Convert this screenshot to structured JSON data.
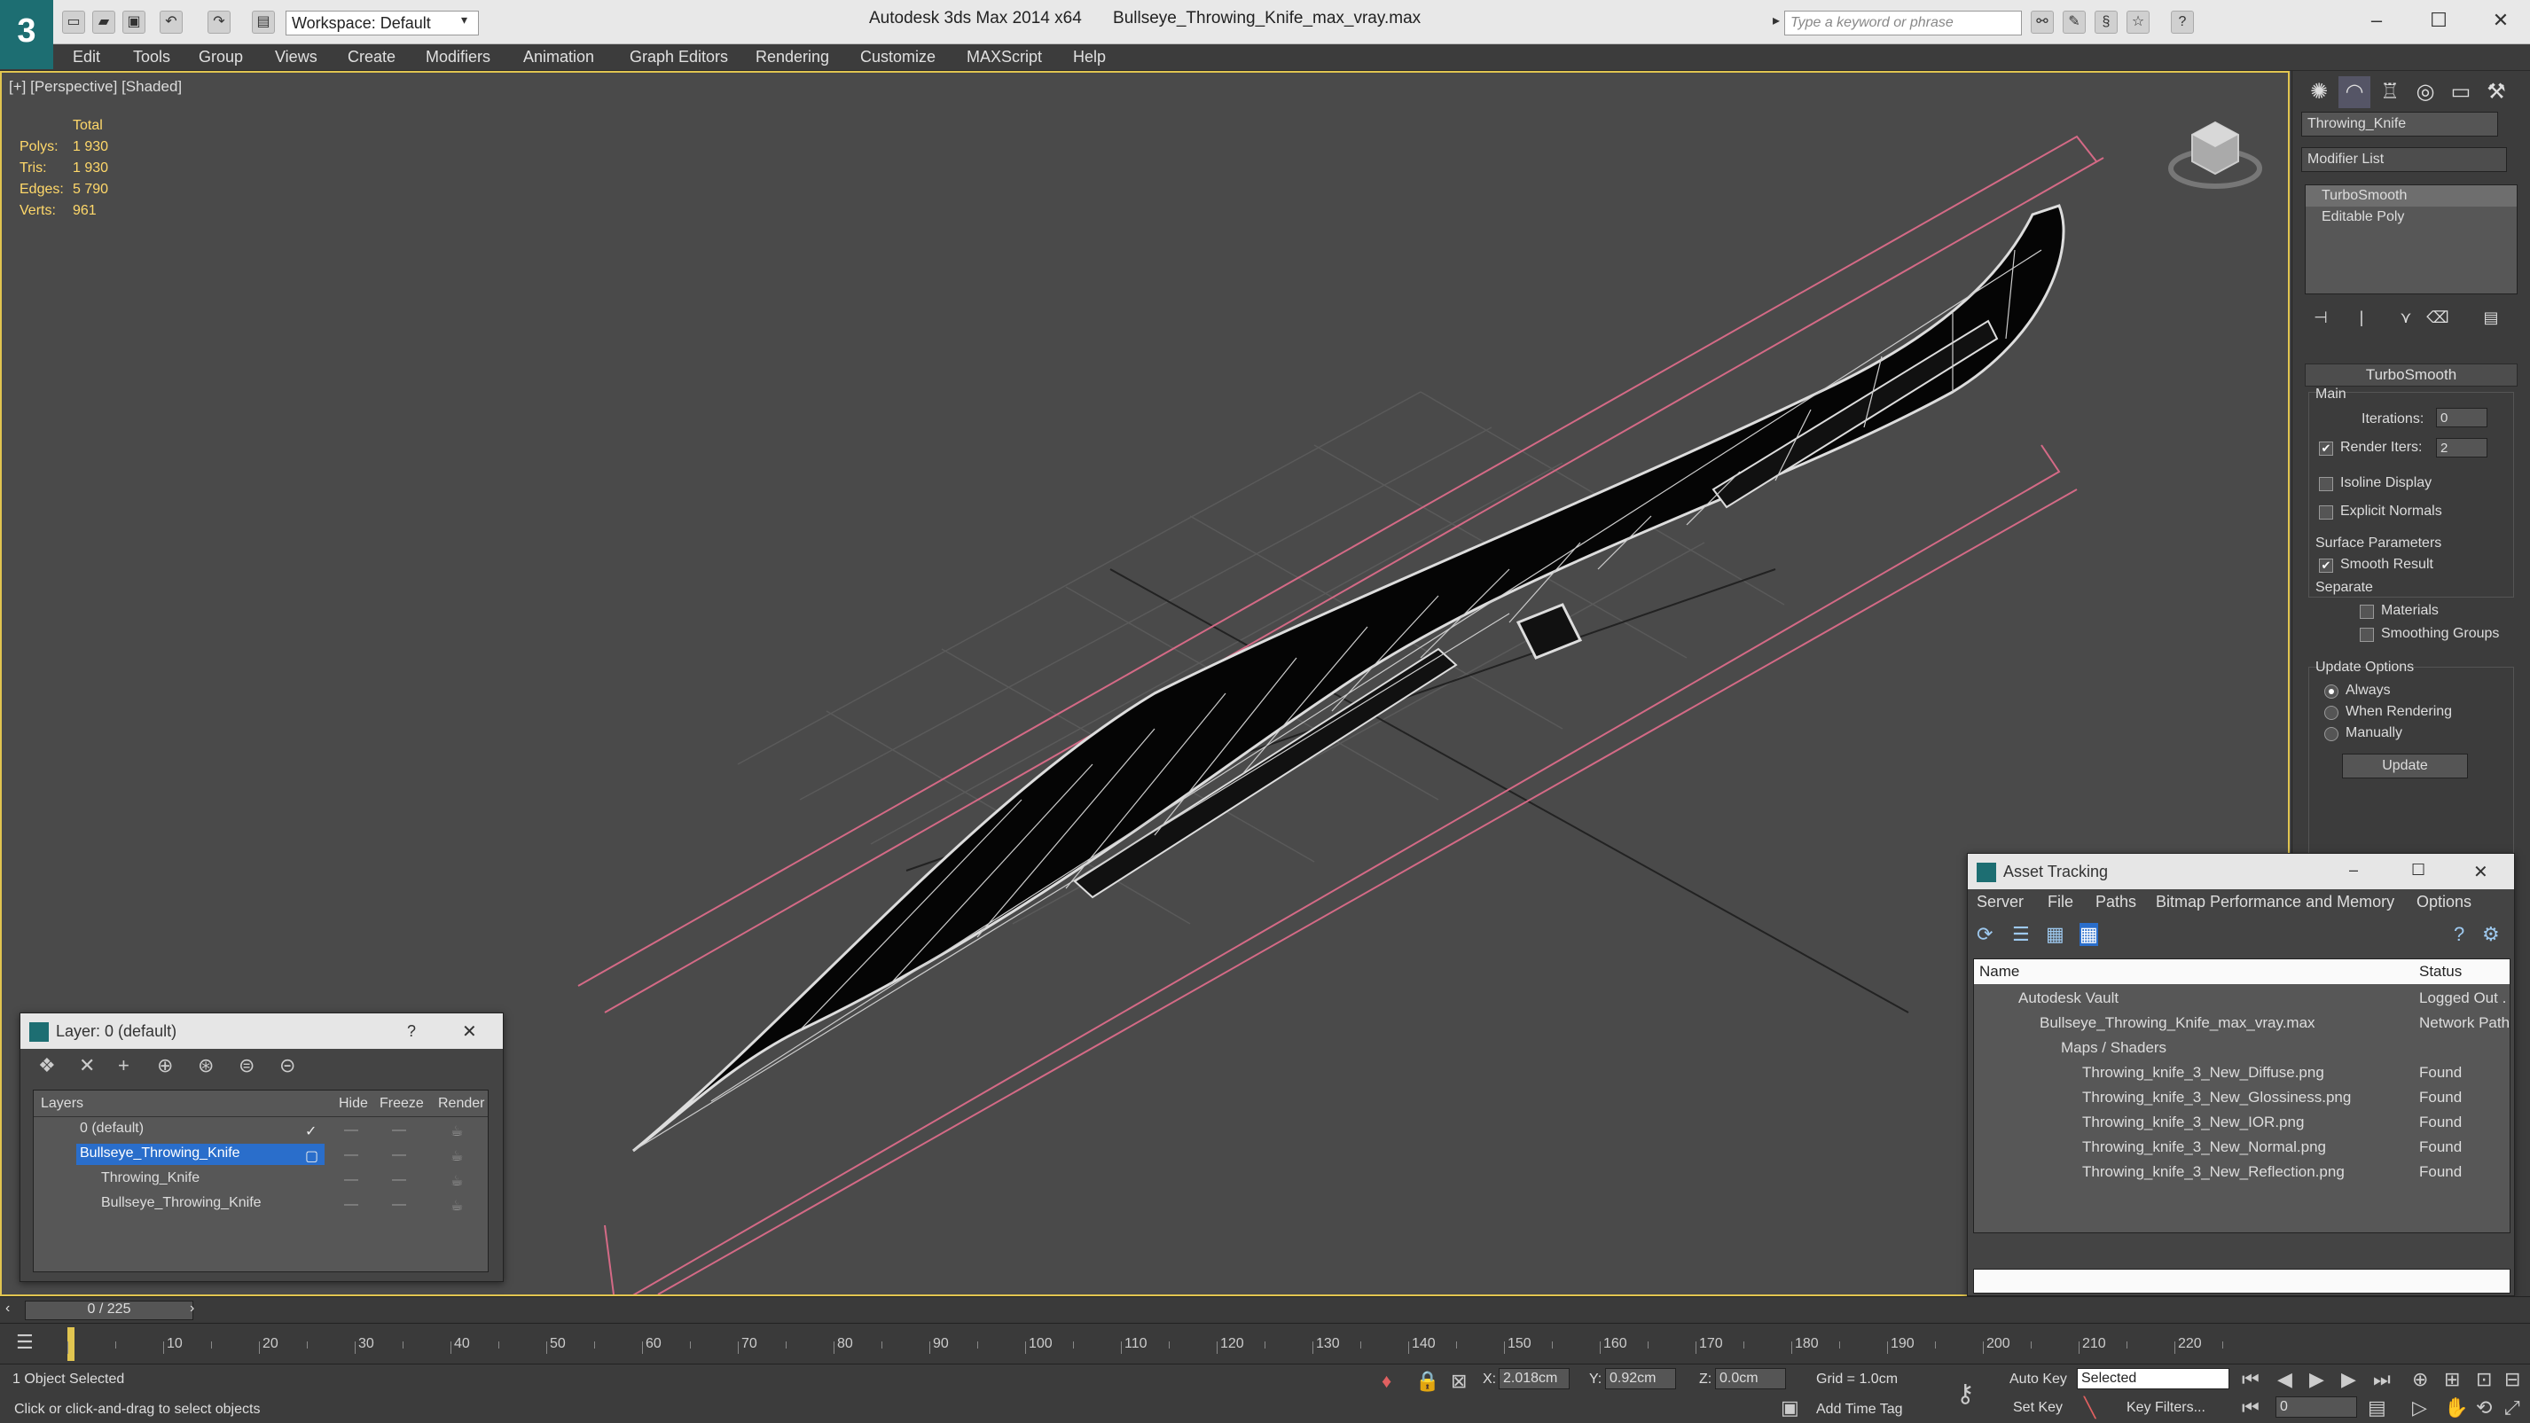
{
  "app": {
    "title": "Autodesk 3ds Max  2014 x64",
    "filename": "Bullseye_Throwing_Knife_max_vray.max",
    "workspace": "Workspace: Default",
    "search_placeholder": "Type a keyword or phrase"
  },
  "menu": [
    "Edit",
    "Tools",
    "Group",
    "Views",
    "Create",
    "Modifiers",
    "Animation",
    "Graph Editors",
    "Rendering",
    "Customize",
    "MAXScript",
    "Help"
  ],
  "viewport": {
    "label": "[+] [Perspective] [Shaded]",
    "stats": {
      "header": "Total",
      "rows": [
        {
          "k": "Polys:",
          "v": "1 930"
        },
        {
          "k": "Tris:",
          "v": "1 930"
        },
        {
          "k": "Edges:",
          "v": "5 790"
        },
        {
          "k": "Verts:",
          "v": "961"
        }
      ]
    }
  },
  "command_panel": {
    "object_name": "Throwing_Knife",
    "modifier_list": "Modifier List",
    "stack": [
      "TurboSmooth",
      "Editable Poly"
    ],
    "rollout": "TurboSmooth",
    "main": "Main",
    "iterations_label": "Iterations:",
    "iterations": "0",
    "render_iters_label": "Render Iters:",
    "render_iters": "2",
    "isoline": "Isoline Display",
    "explicit": "Explicit Normals",
    "surface": "Surface Parameters",
    "smooth": "Smooth Result",
    "separate": "Separate",
    "materials": "Materials",
    "smoothing_groups": "Smoothing Groups",
    "update_options": "Update Options",
    "always": "Always",
    "when_rendering": "When Rendering",
    "manually": "Manually",
    "update_btn": "Update"
  },
  "layer_window": {
    "title": "Layer: 0 (default)",
    "help": "?",
    "cols": {
      "layers": "Layers",
      "hide": "Hide",
      "freeze": "Freeze",
      "render": "Render"
    },
    "rows": [
      "0 (default)",
      "Bullseye_Throwing_Knife",
      "Throwing_Knife",
      "Bullseye_Throwing_Knife"
    ]
  },
  "asset_window": {
    "title": "Asset Tracking",
    "menu": [
      "Server",
      "File",
      "Paths",
      "Bitmap Performance and Memory",
      "Options"
    ],
    "col_name": "Name",
    "col_status": "Status",
    "rows": [
      {
        "name": "Autodesk Vault",
        "status": "Logged Out ."
      },
      {
        "name": "Bullseye_Throwing_Knife_max_vray.max",
        "status": "Network Path"
      },
      {
        "name": "Maps / Shaders",
        "status": ""
      },
      {
        "name": "Throwing_knife_3_New_Diffuse.png",
        "status": "Found"
      },
      {
        "name": "Throwing_knife_3_New_Glossiness.png",
        "status": "Found"
      },
      {
        "name": "Throwing_knife_3_New_IOR.png",
        "status": "Found"
      },
      {
        "name": "Throwing_knife_3_New_Normal.png",
        "status": "Found"
      },
      {
        "name": "Throwing_knife_3_New_Reflection.png",
        "status": "Found"
      }
    ]
  },
  "timeline": {
    "frame": "0 / 225",
    "ticks": [
      "10",
      "20",
      "30",
      "40",
      "50",
      "60",
      "70",
      "80",
      "90",
      "100",
      "110",
      "120",
      "130",
      "140",
      "150",
      "160",
      "170",
      "180",
      "190",
      "200",
      "210",
      "220"
    ]
  },
  "status": {
    "selected": "1 Object Selected",
    "prompt": "Click or click-and-drag to select objects",
    "x_label": "X:",
    "x": "2.018cm",
    "y_label": "Y:",
    "y": "0.92cm",
    "z_label": "Z:",
    "z": "0.0cm",
    "grid": "Grid = 1.0cm",
    "add_time_tag": "Add Time Tag",
    "auto_key": "Auto Key",
    "set_key": "Set Key",
    "selected_dd": "Selected",
    "key_filters": "Key Filters...",
    "frame": "0"
  }
}
